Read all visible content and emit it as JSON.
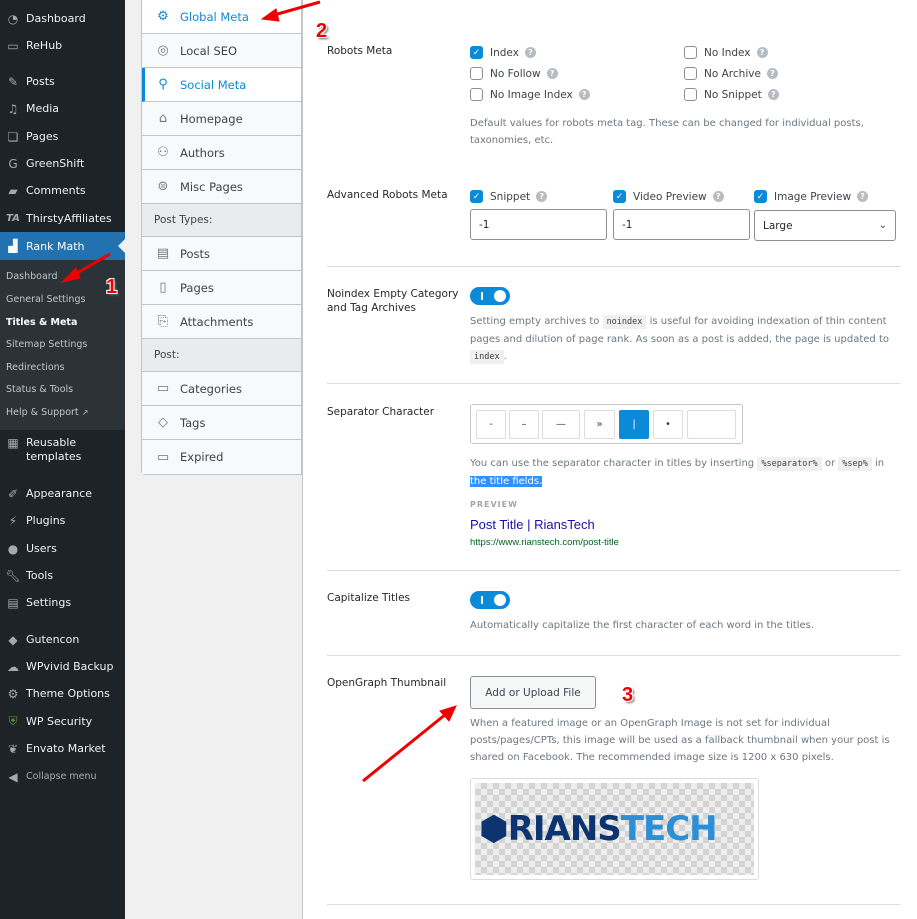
{
  "sidebar": {
    "items": [
      {
        "label": "Dashboard",
        "icon": "dashboard-icon"
      },
      {
        "label": "ReHub",
        "icon": "monitor-icon"
      },
      {
        "label": "Posts",
        "icon": "pin-icon"
      },
      {
        "label": "Media",
        "icon": "media-icon"
      },
      {
        "label": "Pages",
        "icon": "pages-icon"
      },
      {
        "label": "GreenShift",
        "icon": "greenshift-icon"
      },
      {
        "label": "Comments",
        "icon": "comment-icon"
      },
      {
        "label": "ThirstyAffiliates",
        "icon": "ta-icon"
      },
      {
        "label": "Rank Math",
        "icon": "rank-math-icon"
      }
    ],
    "rank_math_submenu": [
      {
        "label": "Dashboard"
      },
      {
        "label": "General Settings"
      },
      {
        "label": "Titles & Meta"
      },
      {
        "label": "Sitemap Settings"
      },
      {
        "label": "Redirections"
      },
      {
        "label": "Status & Tools"
      },
      {
        "label": "Help & Support"
      }
    ],
    "items_after": [
      {
        "label": "Reusable",
        "label2": "templates",
        "icon": "grid-icon"
      },
      {
        "label": "Appearance",
        "icon": "brush-icon"
      },
      {
        "label": "Plugins",
        "icon": "plug-icon"
      },
      {
        "label": "Users",
        "icon": "user-icon"
      },
      {
        "label": "Tools",
        "icon": "wrench-icon"
      },
      {
        "label": "Settings",
        "icon": "settings-icon"
      },
      {
        "label": "Gutencon",
        "icon": "gutencon-icon"
      },
      {
        "label": "WPvivid Backup",
        "icon": "cloud-icon"
      },
      {
        "label": "Theme Options",
        "icon": "gear-icon"
      },
      {
        "label": "WP Security",
        "icon": "shield-icon"
      },
      {
        "label": "Envato Market",
        "icon": "leaf-icon"
      }
    ],
    "collapse_label": "Collapse menu"
  },
  "tabs": {
    "items": [
      {
        "label": "Global Meta"
      },
      {
        "label": "Local SEO"
      },
      {
        "label": "Social Meta"
      },
      {
        "label": "Homepage"
      },
      {
        "label": "Authors"
      },
      {
        "label": "Misc Pages"
      }
    ],
    "post_types_heading": "Post Types:",
    "post_types": [
      {
        "label": "Posts"
      },
      {
        "label": "Pages"
      },
      {
        "label": "Attachments"
      }
    ],
    "post_heading": "Post:",
    "post_tax": [
      {
        "label": "Categories"
      },
      {
        "label": "Tags"
      },
      {
        "label": "Expired"
      }
    ]
  },
  "robots_meta": {
    "label": "Robots Meta",
    "options": [
      {
        "label": "Index",
        "checked": true
      },
      {
        "label": "No Follow",
        "checked": false
      },
      {
        "label": "No Image Index",
        "checked": false
      },
      {
        "label": "No Index",
        "checked": false
      },
      {
        "label": "No Archive",
        "checked": false
      },
      {
        "label": "No Snippet",
        "checked": false
      }
    ],
    "description": "Default values for robots meta tag. These can be changed for individual posts, taxonomies, etc."
  },
  "advanced_robots": {
    "label": "Advanced Robots Meta",
    "snippet": {
      "label": "Snippet",
      "checked": true,
      "value": "-1"
    },
    "video": {
      "label": "Video Preview",
      "checked": true,
      "value": "-1"
    },
    "image": {
      "label": "Image Preview",
      "checked": true,
      "value": "Large"
    }
  },
  "noindex_empty": {
    "label1": "Noindex Empty Category",
    "label2": "and Tag Archives",
    "enabled": true,
    "desc_a": "Setting empty archives to ",
    "code1": "noindex",
    "desc_b": " is useful for avoiding indexation of thin content pages and dilution of page rank. As soon as a post is added, the page is updated to ",
    "code2": "index",
    "desc_c": "."
  },
  "separator": {
    "label": "Separator Character",
    "options": [
      "-",
      "–",
      "—",
      "»",
      "|",
      "•",
      ""
    ],
    "selected": "|",
    "desc_a": "You can use the separator character in titles by inserting ",
    "code1": "%separator%",
    "desc_or": " or ",
    "code2": "%sep%",
    "desc_in": " in",
    "desc_highlight": "the title fields.",
    "preview_label": "PREVIEW",
    "preview_title": "Post Title | RiansTech",
    "preview_url": "https://www.rianstech.com/post-title"
  },
  "capitalize": {
    "label": "Capitalize Titles",
    "enabled": true,
    "description": "Automatically capitalize the first character of each word in the titles."
  },
  "opengraph": {
    "label": "OpenGraph Thumbnail",
    "button": "Add or Upload File",
    "description": "When a featured image or an OpenGraph Image is not set for individual posts/pages/CPTs, this image will be used as a fallback thumbnail when your post is shared on Facebook. The recommended image size is 1200 x 630 pixels.",
    "logo_a": "RIANS",
    "logo_b": "TECH"
  },
  "annotations": {
    "one": "1",
    "two": "2",
    "three": "3"
  },
  "colors": {
    "accent": "#0a8ad8",
    "sidebar_bg": "#1d2327",
    "active_menu": "#2271b1",
    "annotation": "#e00000"
  }
}
